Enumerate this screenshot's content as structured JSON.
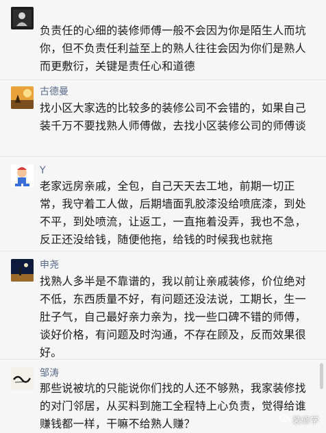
{
  "comments": [
    {
      "name": "",
      "text": "负责任的心细的装修师傅一般不会因为你是陌生人而坑你，但不负责任利益至上的熟人往往会因为你们是熟人而更敷衍，关键是责任心和道德"
    },
    {
      "name": "古德曼",
      "text": "找小区大家选的比较多的装修公司不会错的，如果自己装千万不要找熟人师傅做，去找小区装修公司的师傅谈"
    },
    {
      "name": "Y",
      "text": "老家远房亲戚，全包，自己天天去工地，前期一切正常，我守着工人做，后期墙面乳胶漆没给喷底漆，到处不平，到处喷流，让返工，一直拖着没弄，我也不急，反正还没给钱，随便他拖，给钱的时候我也就拖"
    },
    {
      "name": "申尧",
      "text": "找熟人多半是不靠谱的，我以前让亲戚装修，价位绝对不低，东西质量不好，有问题还没法说，工期长，生一肚子气，自己最好亲力亲为，找一些口碑不错的师傅，谈好价格，有问题及时沟通，不存在顾及，反而效果很好。"
    },
    {
      "name": "邹涛",
      "text": "那些说被坑的只能说你们找的人还不够熟，我家装修找的对门邻居，从买料到施工全程特上心负责，觉得给谁赚钱都一样，干嘛不给熟人赚？"
    }
  ],
  "watermark": {
    "text": "装修学",
    "icon": "wechat-icon"
  },
  "colors": {
    "name": "#5a6a8a",
    "text": "#1a1a1a",
    "background": "#f6f6f6"
  }
}
